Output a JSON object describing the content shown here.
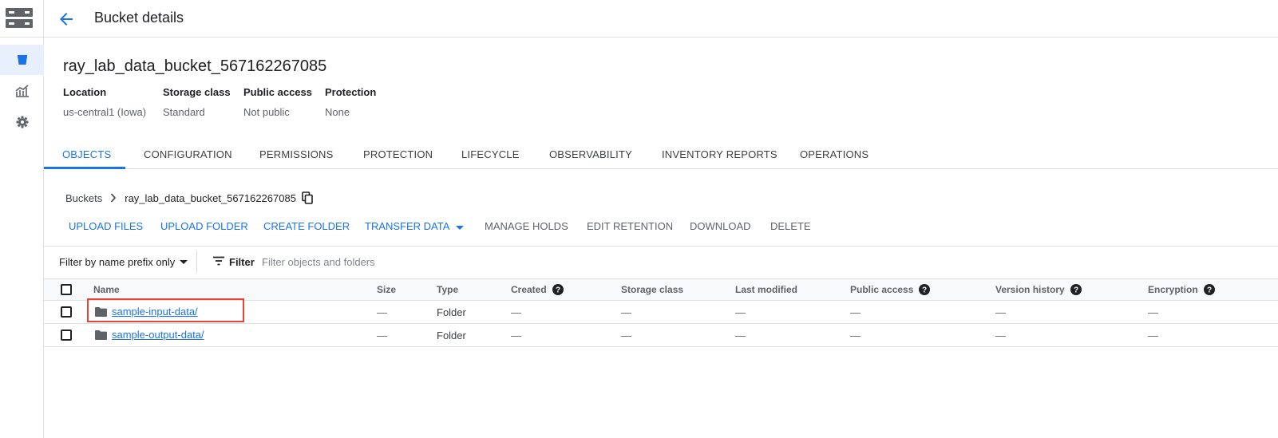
{
  "header": {
    "title": "Bucket details"
  },
  "bucket": {
    "name": "ray_lab_data_bucket_567162267085",
    "meta": [
      {
        "key": "Location",
        "value": "us-central1 (Iowa)"
      },
      {
        "key": "Storage class",
        "value": "Standard"
      },
      {
        "key": "Public access",
        "value": "Not public"
      },
      {
        "key": "Protection",
        "value": "None"
      }
    ]
  },
  "tabs": [
    "OBJECTS",
    "CONFIGURATION",
    "PERMISSIONS",
    "PROTECTION",
    "LIFECYCLE",
    "OBSERVABILITY",
    "INVENTORY REPORTS",
    "OPERATIONS"
  ],
  "breadcrumb": {
    "root": "Buckets",
    "current": "ray_lab_data_bucket_567162267085"
  },
  "toolbar": {
    "upload_files": "UPLOAD FILES",
    "upload_folder": "UPLOAD FOLDER",
    "create_folder": "CREATE FOLDER",
    "transfer_data": "TRANSFER DATA",
    "manage_holds": "MANAGE HOLDS",
    "edit_retention": "EDIT RETENTION",
    "download": "DOWNLOAD",
    "delete": "DELETE"
  },
  "filter": {
    "prefix_label": "Filter by name prefix only",
    "label": "Filter",
    "placeholder": "Filter objects and folders"
  },
  "table": {
    "columns": [
      "Name",
      "Size",
      "Type",
      "Created",
      "Storage class",
      "Last modified",
      "Public access",
      "Version history",
      "Encryption"
    ],
    "rows": [
      {
        "name": "sample-input-data/",
        "size": "—",
        "type": "Folder",
        "created": "—",
        "storage_class": "—",
        "last_modified": "—",
        "public_access": "—",
        "version_history": "—",
        "encryption": "—"
      },
      {
        "name": "sample-output-data/",
        "size": "—",
        "type": "Folder",
        "created": "—",
        "storage_class": "—",
        "last_modified": "—",
        "public_access": "—",
        "version_history": "—",
        "encryption": "—"
      }
    ]
  },
  "colors": {
    "accent": "#1a73e8",
    "highlight": "#ea4335",
    "active_rail": "#e8f0fe"
  },
  "icons": [
    "storage-logo-icon",
    "bucket-icon",
    "monitoring-icon",
    "settings-icon",
    "back-arrow-icon",
    "chevron-right-icon",
    "copy-icon",
    "dropdown-caret-icon",
    "filter-icon",
    "help-icon",
    "folder-icon"
  ]
}
